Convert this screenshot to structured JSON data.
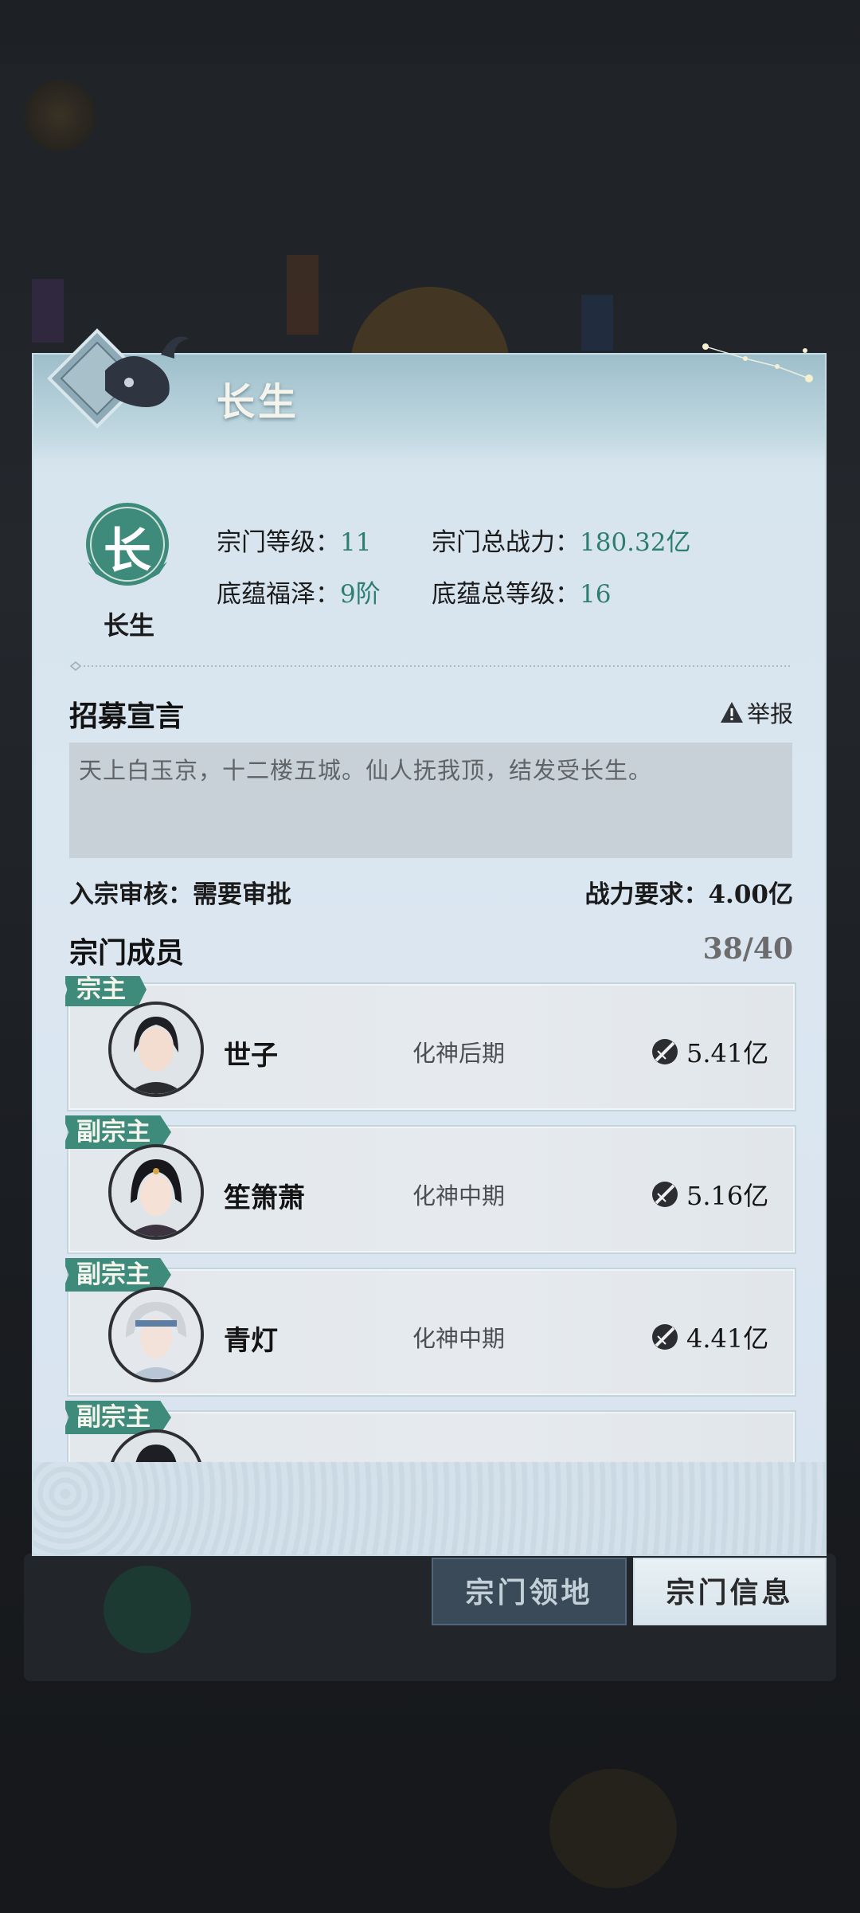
{
  "panel": {
    "title": "长生"
  },
  "sect": {
    "badge_char": "长",
    "name": "长生",
    "level_label": "宗门等级：",
    "level_value": "11",
    "total_power_label": "宗门总战力：",
    "total_power_value": "180.32亿",
    "heritage_label": "底蕴福泽：",
    "heritage_value": "9阶",
    "heritage_level_label": "底蕴总等级：",
    "heritage_level_value": "16"
  },
  "recruit": {
    "heading": "招募宣言",
    "report_label": "举报",
    "declaration": "天上白玉京，十二楼五城。仙人抚我顶，结发受长生。",
    "review": "入宗审核：需要审批",
    "power_requirement": "战力要求：4.00亿"
  },
  "members": {
    "heading": "宗门成员",
    "count": "38/40",
    "list": [
      {
        "role": "宗主",
        "name": "世子",
        "realm": "化神后期",
        "power": "5.41亿"
      },
      {
        "role": "副宗主",
        "name": "笙箫萧",
        "realm": "化神中期",
        "power": "5.16亿"
      },
      {
        "role": "副宗主",
        "name": "青灯",
        "realm": "化神中期",
        "power": "4.41亿"
      },
      {
        "role": "副宗主",
        "name": "",
        "realm": "",
        "power": ""
      }
    ]
  },
  "tabs": {
    "territory": "宗门领地",
    "info": "宗门信息"
  },
  "colors": {
    "accent": "#3f8b7b",
    "value_text": "#2c7d72"
  },
  "icons": {
    "report": "warning-icon",
    "power": "sword-power-icon"
  }
}
